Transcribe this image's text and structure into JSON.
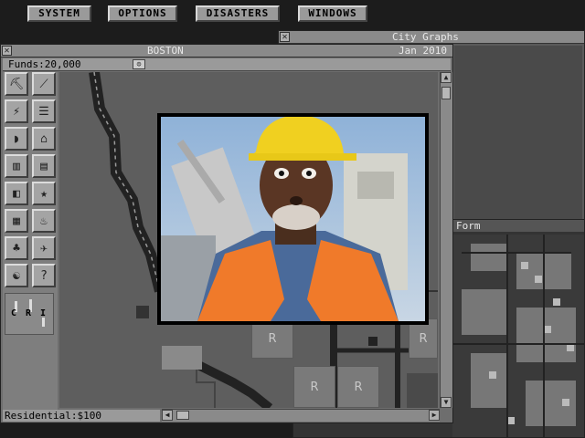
{
  "menu": {
    "items": [
      {
        "label": "SYSTEM"
      },
      {
        "label": "OPTIONS"
      },
      {
        "label": "DISASTERS"
      },
      {
        "label": "WINDOWS"
      }
    ]
  },
  "graphs_window": {
    "title": "City Graphs"
  },
  "map_window": {
    "title_fragment": "Form"
  },
  "city_window": {
    "city_name": "BOSTON",
    "date": "Jan 2010",
    "funds": "Funds:20,000",
    "status": "Residential:$100",
    "demand": {
      "labels": [
        "C",
        "R",
        "I"
      ]
    },
    "zone_letter": "R"
  },
  "popup": {
    "photo_icon": "construction-worker-photo"
  },
  "colors": {
    "background": "#1c1c1c",
    "panel": "#9a9a9a",
    "road": "#2a2a2a",
    "vest": "#f07a2a",
    "helmet": "#f0d020"
  }
}
